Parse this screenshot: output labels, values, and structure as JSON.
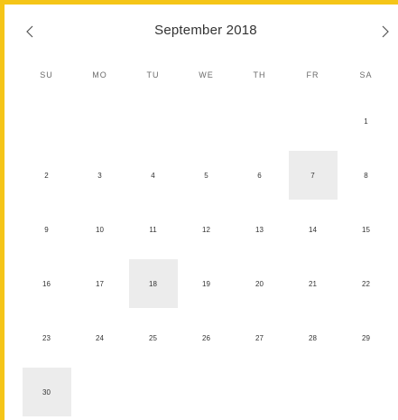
{
  "header": {
    "title": "September 2018",
    "prev_icon": "chevron-left-icon",
    "next_icon": "chevron-right-icon"
  },
  "weekdays": [
    "SU",
    "MO",
    "TU",
    "WE",
    "TH",
    "FR",
    "SA"
  ],
  "weeks": [
    [
      "",
      "",
      "",
      "",
      "",
      "",
      "1"
    ],
    [
      "2",
      "3",
      "4",
      "5",
      "6",
      "7",
      "8"
    ],
    [
      "9",
      "10",
      "11",
      "12",
      "13",
      "14",
      "15"
    ],
    [
      "16",
      "17",
      "18",
      "19",
      "20",
      "21",
      "22"
    ],
    [
      "23",
      "24",
      "25",
      "26",
      "27",
      "28",
      "29"
    ],
    [
      "30",
      "",
      "",
      "",
      "",
      "",
      ""
    ]
  ],
  "highlighted_days": [
    "7",
    "18",
    "30"
  ],
  "colors": {
    "border": "#f5c518",
    "highlight": "#ececec",
    "text": "#333333"
  }
}
